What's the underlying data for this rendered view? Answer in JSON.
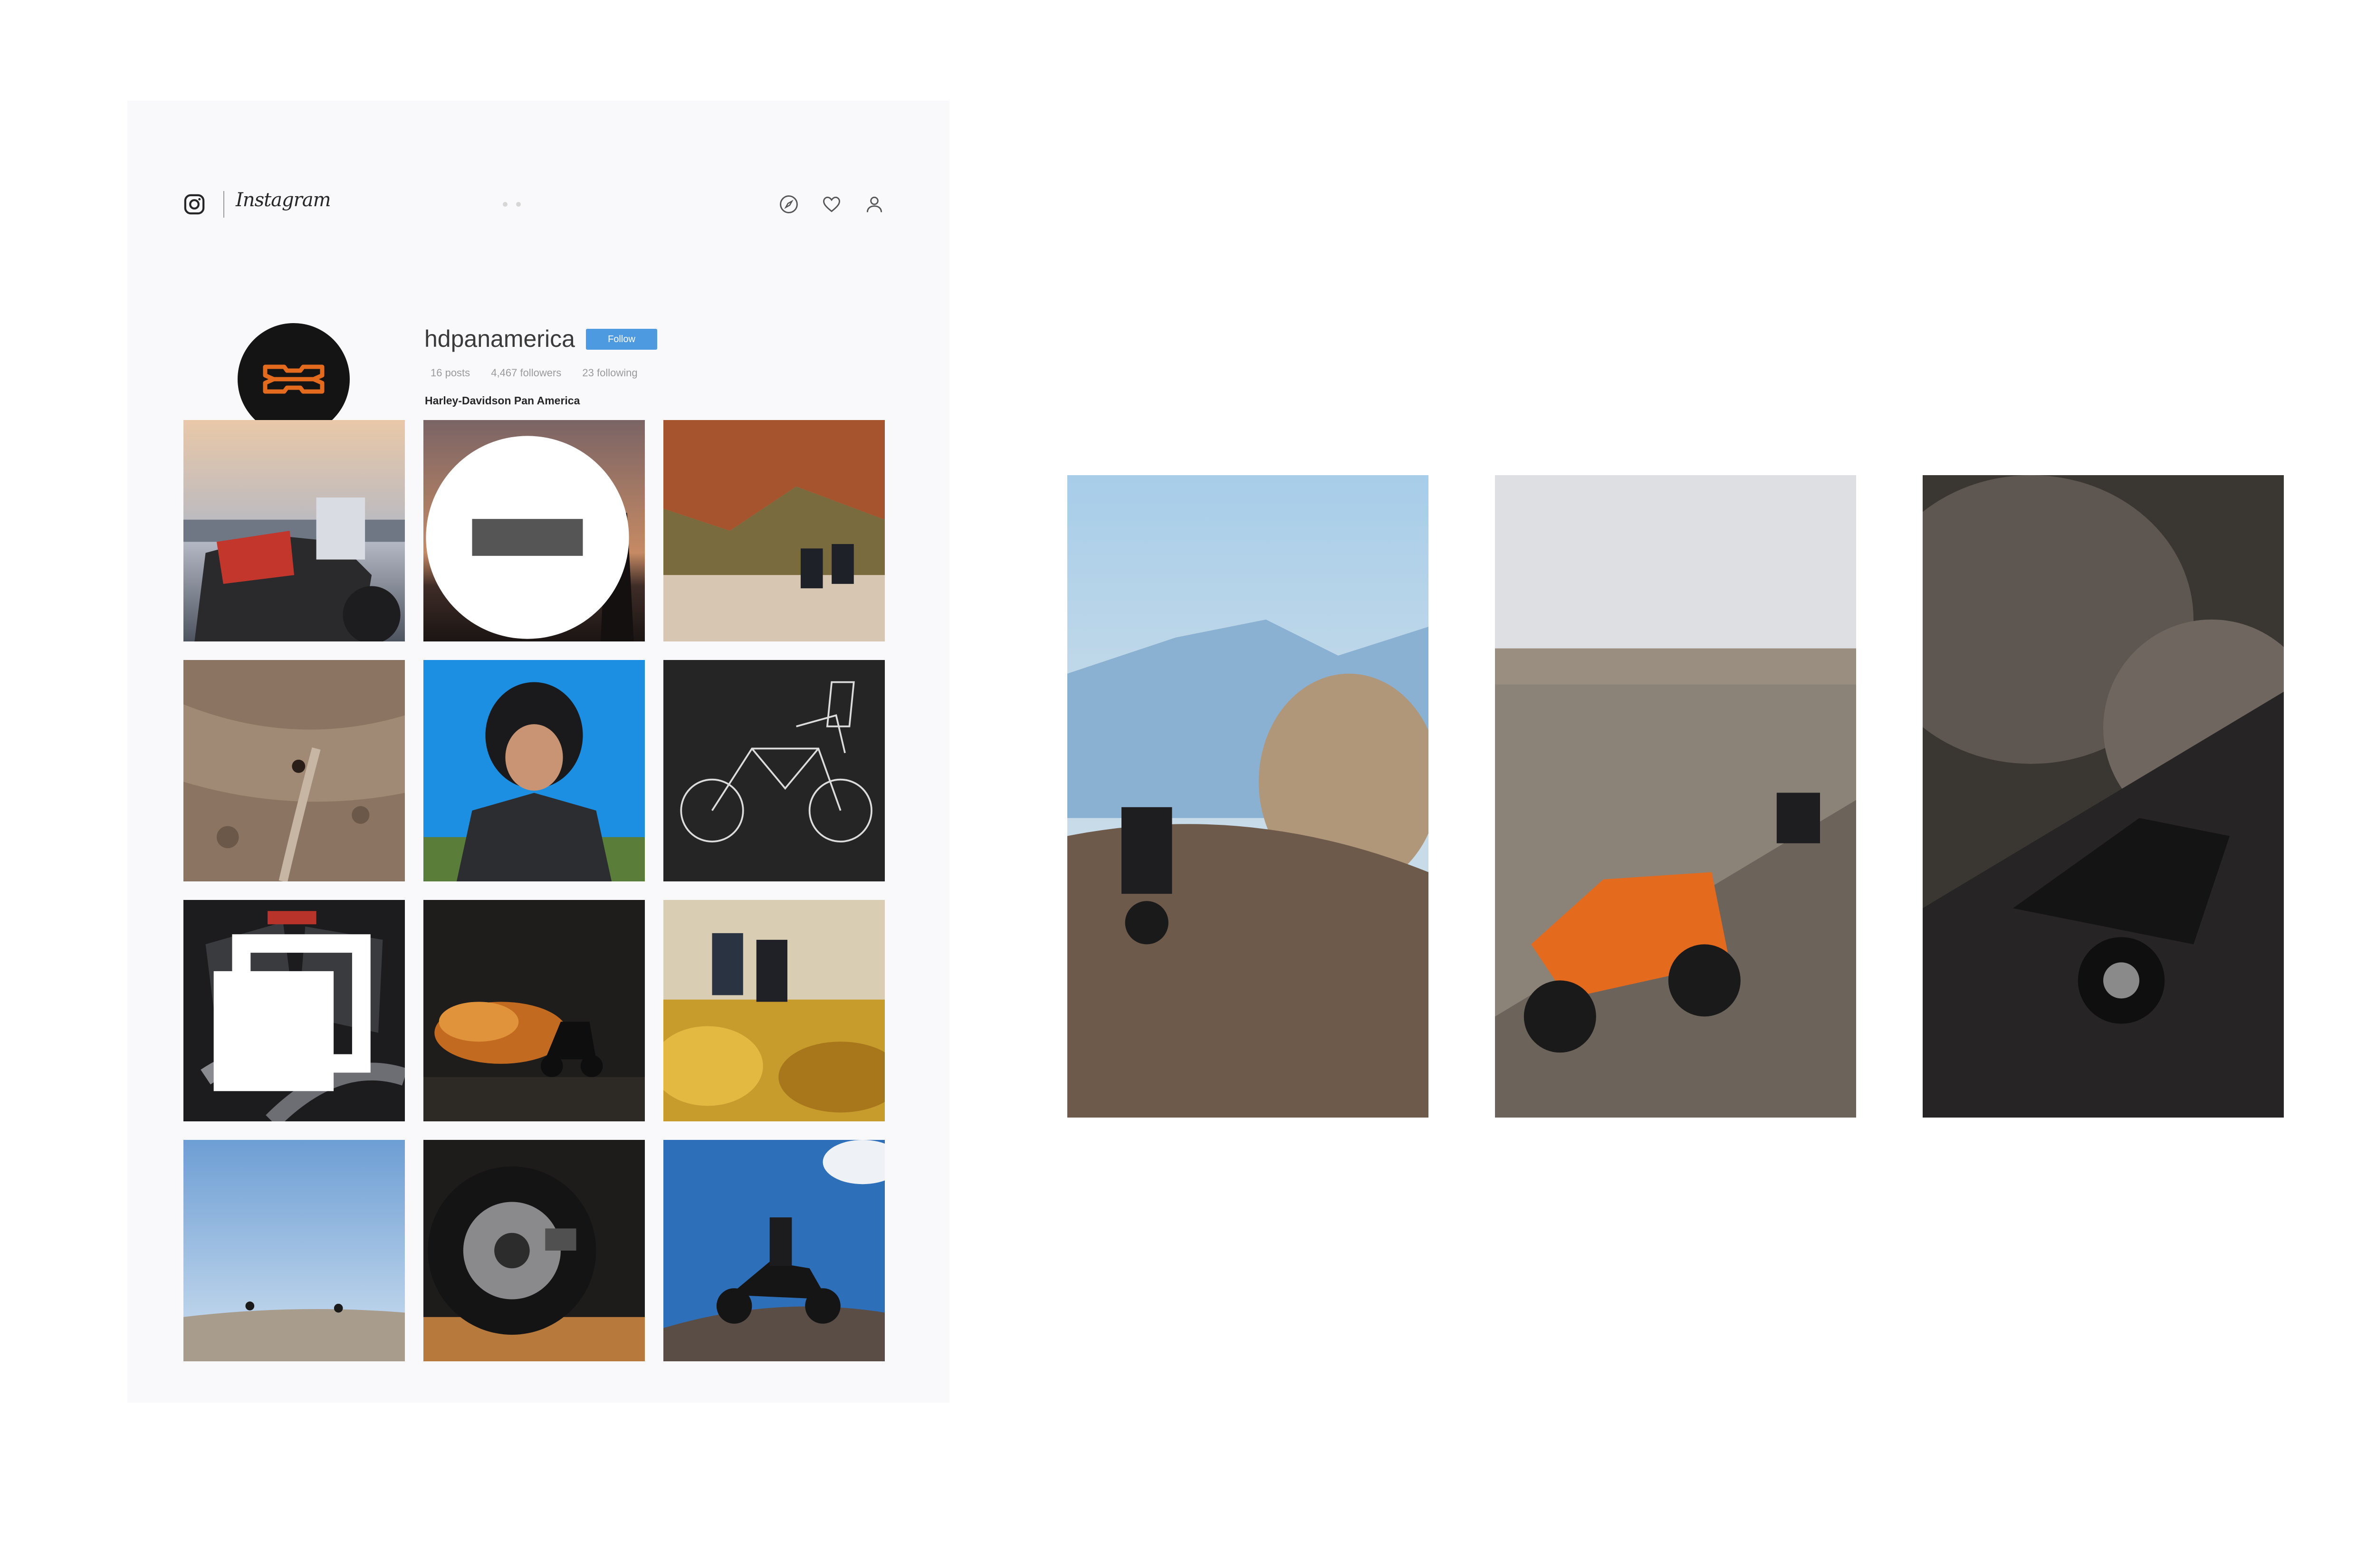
{
  "header": {
    "brand_wordmark": "Instagram",
    "icons": [
      "instagram-logo-icon",
      "compass-icon",
      "heart-icon",
      "user-icon"
    ]
  },
  "profile": {
    "username": "hdpanamerica",
    "follow_label": "Follow",
    "posts": "16 posts",
    "followers": "4,467 followers",
    "following": "23 following",
    "full_name": "Harley-Davidson Pan America"
  },
  "colors": {
    "accent": "#4e9ae0",
    "brand_orange": "#e46a1e",
    "panel_bg": "#f9f9fb"
  },
  "posts_grid": {
    "rows": 4,
    "columns": 3,
    "tiles": [
      {
        "subject": "motorcycle-closeup"
      },
      {
        "subject": "sunset-silhouette",
        "badge": "video-icon"
      },
      {
        "subject": "red-rocks-riders"
      },
      {
        "subject": "desert-rider-aerial"
      },
      {
        "subject": "rider-helmet-portrait"
      },
      {
        "subject": "motorcycle-line-drawing"
      },
      {
        "subject": "engine-closeup",
        "badge": "carousel-icon"
      },
      {
        "subject": "dust-cloud-rider"
      },
      {
        "subject": "two-riders-field"
      },
      {
        "subject": "distant-riders-sky"
      },
      {
        "subject": "wheel-brake-closeup"
      },
      {
        "subject": "rider-hilltop"
      }
    ]
  },
  "stories": [
    {
      "subject": "rider-mountain-dust"
    },
    {
      "subject": "two-riders-badlands"
    },
    {
      "subject": "rider-dark-dust"
    }
  ]
}
